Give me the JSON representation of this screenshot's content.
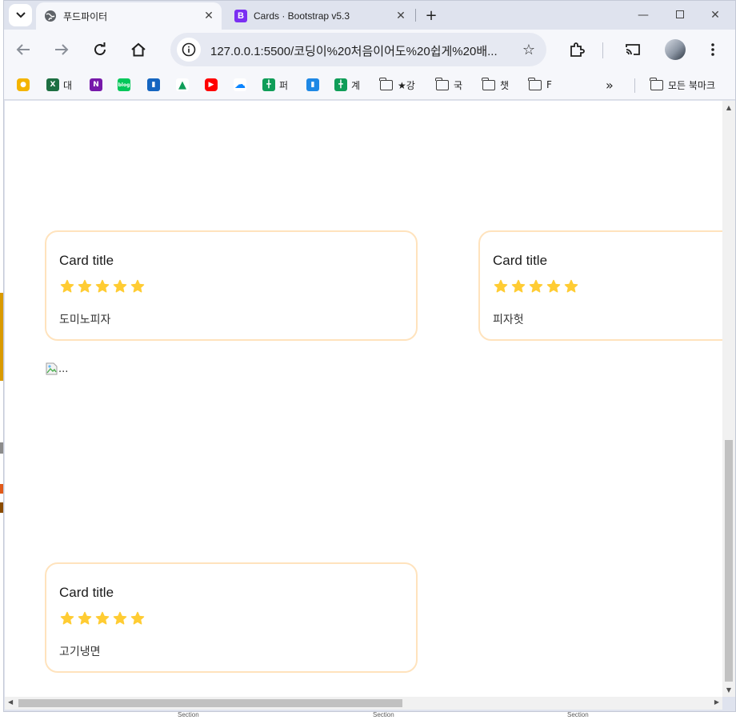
{
  "desktop": {
    "section_labels": [
      "Section",
      "Section",
      "Section"
    ],
    "colors": {
      "orange": "#d99a00",
      "brown": "#8a4b00",
      "gray": "#8c8c8c"
    }
  },
  "browser": {
    "tabs": [
      {
        "title": "푸드파이터",
        "active": true,
        "favicon": "globe-icon"
      },
      {
        "title": "Cards · Bootstrap v5.3",
        "active": false,
        "favicon": "bootstrap-icon"
      }
    ],
    "address": {
      "url": "127.0.0.1:5500/코딩이%20처음이어도%20쉽게%20배..."
    },
    "bookmarks": [
      {
        "label": "",
        "icon": "keep-icon",
        "color": "#f4b400"
      },
      {
        "label": "대",
        "icon": "excel-icon",
        "color": "#1d6f42"
      },
      {
        "label": "",
        "icon": "onenote-icon",
        "color": "#7719aa"
      },
      {
        "label": "",
        "icon": "naver-blog-icon",
        "color": "#03c75a"
      },
      {
        "label": "",
        "icon": "app-icon",
        "color": "#1565c0"
      },
      {
        "label": "",
        "icon": "google-drive-icon",
        "color": "#0f9d58"
      },
      {
        "label": "",
        "icon": "youtube-icon",
        "color": "#ff0000"
      },
      {
        "label": "",
        "icon": "onedrive-icon",
        "color": "#0a84ff"
      },
      {
        "label": "퍼",
        "icon": "sheets-icon",
        "color": "#0f9d58"
      },
      {
        "label": "",
        "icon": "app-icon",
        "color": "#1e88e5"
      },
      {
        "label": "계",
        "icon": "sheets-icon",
        "color": "#0f9d58"
      },
      {
        "label": "★강",
        "icon": "folder-icon"
      },
      {
        "label": "국",
        "icon": "folder-icon"
      },
      {
        "label": "챗",
        "icon": "folder-icon"
      },
      {
        "label": "F",
        "icon": "folder-icon"
      }
    ],
    "overflow_label": "»",
    "all_bookmarks_label": "모든 북마크"
  },
  "page": {
    "cards": [
      {
        "title": "Card title",
        "rating": 5,
        "text": "도미노피자"
      },
      {
        "title": "Card title",
        "rating": 5,
        "text": "피자헛"
      },
      {
        "title": "Card title",
        "rating": 5,
        "text": "고기냉면"
      }
    ],
    "broken_image_alt": "...",
    "colors": {
      "card_border": "#ffe3bd",
      "star": "#ffcc33"
    }
  }
}
